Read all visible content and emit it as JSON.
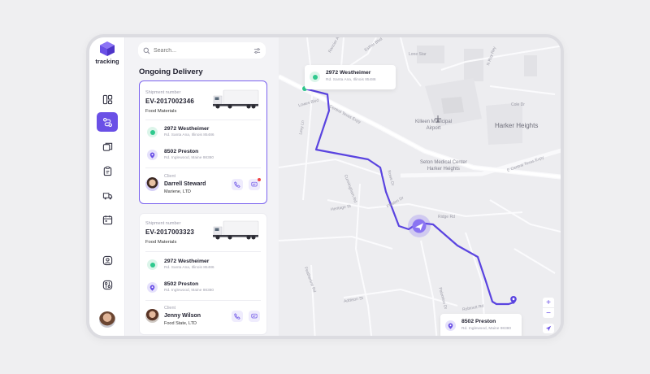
{
  "app": {
    "logo_text": "tracking"
  },
  "search": {
    "placeholder": "Search..."
  },
  "panel": {
    "title": "Ongoing Delivery"
  },
  "deliveries": [
    {
      "shipment_label": "Shipment number",
      "shipment_number": "EV-2017002346",
      "category": "Food Materials",
      "origin": {
        "name": "2972 Westheimer",
        "address": "Rd. Santa Ana, Illinois 85486"
      },
      "destination": {
        "name": "8502 Preston",
        "address": "Rd. Inglewood, Maine 98380"
      },
      "client_label": "Client",
      "client_name": "Darrell Steward",
      "client_company": "Mariene, LTD",
      "selected": true,
      "has_notification": true
    },
    {
      "shipment_label": "Shipment number",
      "shipment_number": "EV-2017003323",
      "category": "Food Materials",
      "origin": {
        "name": "2972 Westheimer",
        "address": "Rd. Santa Ana, Illinois 85486"
      },
      "destination": {
        "name": "8502 Preston",
        "address": "Rd. Inglewood, Maine 98380"
      },
      "client_label": "Client",
      "client_name": "Jenny Wilson",
      "client_company": "Food State, LTD",
      "selected": false,
      "has_notification": false
    }
  ],
  "map": {
    "origin_popup": {
      "name": "2972 Westheimer",
      "address": "Rd. Santa Ana, Illinois 85486"
    },
    "destination_popup": {
      "name": "8502 Preston",
      "address": "Rd. Inglewood, Maine 98380"
    },
    "places": {
      "airport": "Killeen Municipal\nAirport",
      "medical": "Seton Medical Center\nHarker Heights",
      "city": "Harker Heights"
    },
    "streets": {
      "s1": "Rancier Ave",
      "s2": "Lone Star",
      "s3": "N Roy Rey",
      "s4": "Esther Blvd",
      "s5": "Central Texas Expy",
      "s6": "Lowes Blvd",
      "s7": "Cole Dr",
      "s8": "Cunningham Rd",
      "s9": "Bacon Ranch Rd",
      "s10": "E Central Texas Expy",
      "s11": "Lexy Ln",
      "s12": "Reese Creek",
      "s13": "Watercrest Rd",
      "s14": "Stan Schlueter Loop",
      "s15": "Heritage St",
      "s16": "Rowe Dr",
      "s17": "Fleston Dr",
      "s18": "Bacon Dr",
      "s19": "Ridge Rd",
      "s20": "Addison St",
      "s21": "Featherline Rd",
      "s22": "Palomino Dr",
      "s23": "Robinett Rd",
      "s24": "Prospector Trl",
      "s25": "Chapel Hill Rd",
      "s26": "Old Copper Rd"
    },
    "zoom_in": "+",
    "zoom_out": "−"
  },
  "colors": {
    "accent": "#6a50e6",
    "route": "#5a44e0",
    "origin": "#2fc98e"
  }
}
